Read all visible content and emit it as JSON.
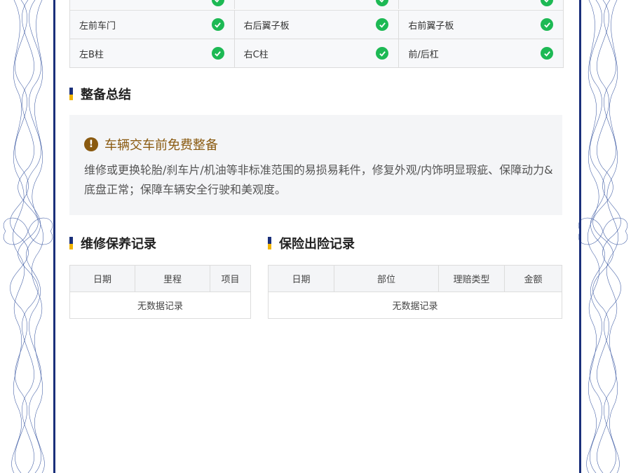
{
  "inspection": {
    "rows": [
      [
        "",
        "",
        ""
      ],
      [
        "左前车门",
        "右后翼子板",
        "右前翼子板"
      ],
      [
        "左B柱",
        "右C柱",
        "前/后杠"
      ]
    ],
    "status_color": "#1db954"
  },
  "summary": {
    "title": "整备总结",
    "headline": "车辆交车前免费整备",
    "description": "维修或更换轮胎/刹车片/机油等非标准范围的易损易耗件，修复外观/内饰明显瑕疵、保障动力&底盘正常；保障车辆安全行驶和美观度。"
  },
  "maintenance": {
    "title": "维修保养记录",
    "columns": [
      "日期",
      "里程",
      "项目"
    ],
    "empty_text": "无数据记录"
  },
  "insurance": {
    "title": "保险出险记录",
    "columns": [
      "日期",
      "部位",
      "理赔类型",
      "金额"
    ],
    "empty_text": "无数据记录"
  },
  "colors": {
    "frame_blue": "#1a2f7a",
    "accent_yellow": "#f0b400",
    "warning_brown": "#8a5a10"
  },
  "icons": {
    "status": "check-circle-icon",
    "warning": "exclamation-circle-icon"
  }
}
